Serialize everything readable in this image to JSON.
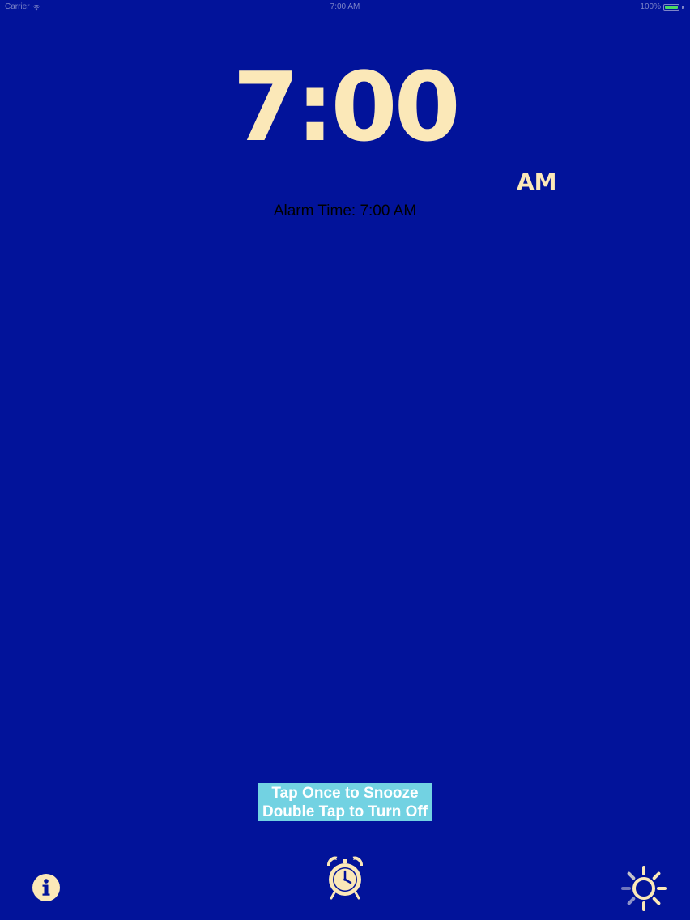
{
  "status_bar": {
    "carrier": "Carrier",
    "time": "7:00 AM",
    "battery_percent": "100%",
    "battery_level": 1.0,
    "icons": [
      "wifi-icon",
      "battery-icon"
    ]
  },
  "clock": {
    "time": "7:00",
    "period": "AM"
  },
  "alarm": {
    "label": "Alarm Time: 7:00 AM"
  },
  "snooze": {
    "line1": "Tap Once to Snooze",
    "line2": "Double Tap to Turn Off"
  },
  "toolbar": {
    "buttons": [
      {
        "icon": "info-icon"
      },
      {
        "icon": "alarm-clock-icon"
      },
      {
        "icon": "brightness-icon"
      }
    ]
  },
  "colors": {
    "background": "#02139a",
    "clock_text": "#fbe8b8",
    "snooze_background": "#72d2e2",
    "battery": "#4cd964"
  }
}
